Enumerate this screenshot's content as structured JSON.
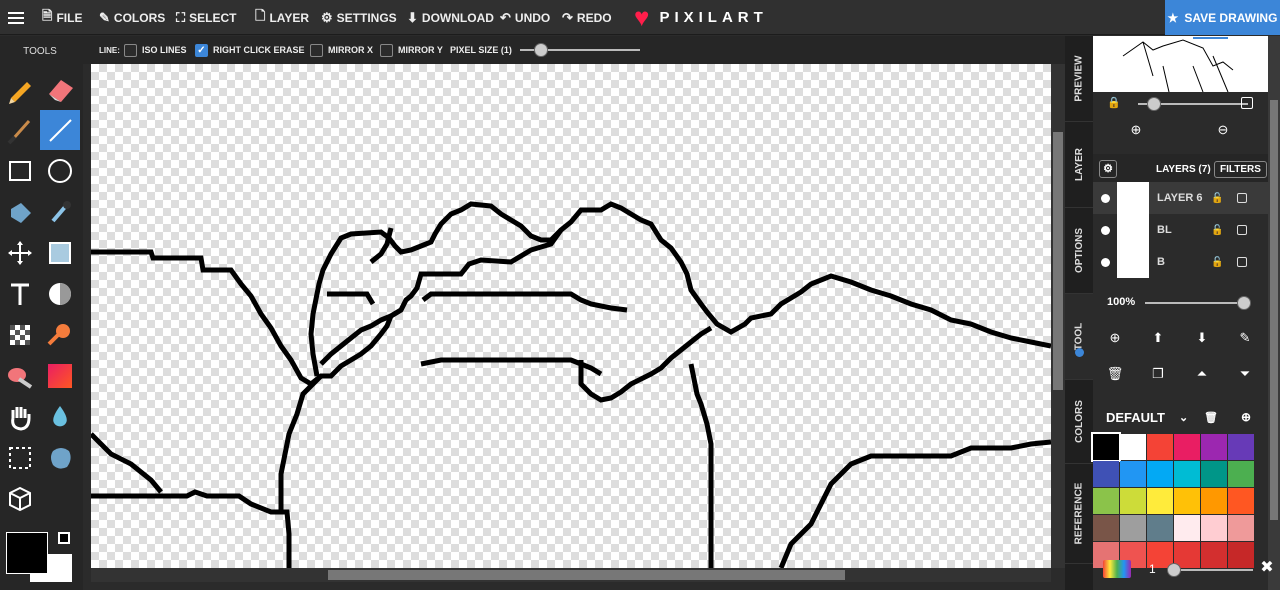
{
  "topbar": {
    "menu": [
      {
        "id": "file",
        "label": "FILE",
        "icon": "file-icon"
      },
      {
        "id": "colors",
        "label": "COLORS",
        "icon": "brush-icon"
      },
      {
        "id": "select",
        "label": "SELECT",
        "icon": "select-icon"
      },
      {
        "id": "layer",
        "label": "LAYER",
        "icon": "layer-doc-icon"
      },
      {
        "id": "settings",
        "label": "SETTINGS",
        "icon": "gears-icon"
      },
      {
        "id": "download",
        "label": "DOWNLOAD",
        "icon": "download-icon"
      },
      {
        "id": "undo",
        "label": "UNDO",
        "icon": "undo-icon"
      },
      {
        "id": "redo",
        "label": "REDO",
        "icon": "redo-icon"
      }
    ],
    "logo": "PIXILART",
    "save_label": "SAVE DRAWING"
  },
  "tools": {
    "title": "TOOLS",
    "selected": "line-tool"
  },
  "options": {
    "line_label": "LINE:",
    "iso_lines": "ISO LINES",
    "iso_checked": false,
    "right_click_erase": "RIGHT CLICK ERASE",
    "rce_checked": true,
    "mirror_x": "MIRROR X",
    "mirror_y": "MIRROR Y",
    "pixel_size": "PIXEL SIZE (1)"
  },
  "side_tabs": [
    "PREVIEW",
    "LAYER",
    "OPTIONS",
    "TOOL",
    "COLORS",
    "REFERENCE"
  ],
  "layers": {
    "header": "LAYERS (7)",
    "filters": "FILTERS",
    "items": [
      {
        "name": "LAYER 6",
        "selected": true
      },
      {
        "name": "BL",
        "selected": false
      },
      {
        "name": "B",
        "selected": false
      }
    ],
    "opacity": "100%"
  },
  "palette": {
    "name": "DEFAULT",
    "colors": [
      "#000000",
      "#ffffff",
      "#f44336",
      "#e91e63",
      "#9c27b0",
      "#673ab7",
      "#3f51b5",
      "#2196f3",
      "#03a9f4",
      "#00bcd4",
      "#009688",
      "#4caf50",
      "#8bc34a",
      "#cddc39",
      "#ffeb3b",
      "#ffc107",
      "#ff9800",
      "#ff5722",
      "#795548",
      "#9e9e9e",
      "#607d8b",
      "#ffebee",
      "#ffcdd2",
      "#ef9a9a",
      "#e57373",
      "#ef5350",
      "#f44336",
      "#e53935",
      "#d32f2f",
      "#c62828"
    ],
    "primary": "#000000",
    "secondary": "#ffffff",
    "brush_size": "1"
  }
}
